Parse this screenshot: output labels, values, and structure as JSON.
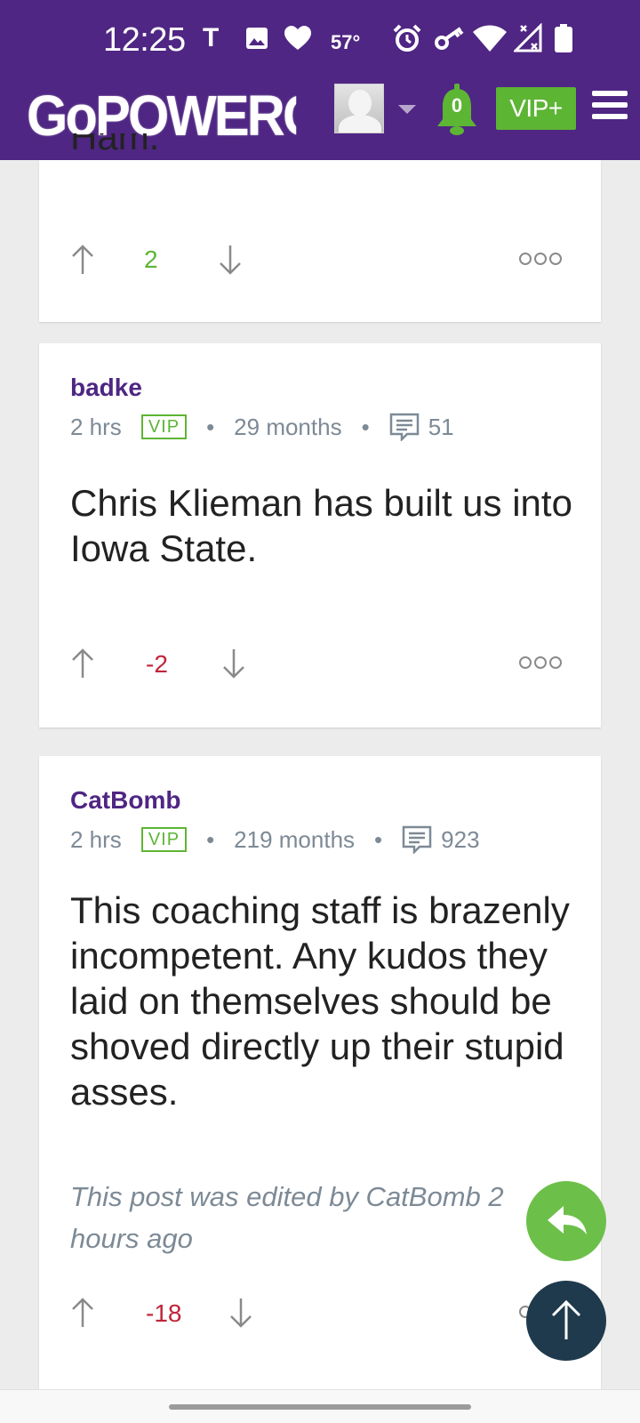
{
  "status_bar": {
    "time": "12:25",
    "temperature": "57°"
  },
  "header": {
    "logo_text": "GoPOWERCAT",
    "notification_count": "0",
    "vip_button_label": "VIP+"
  },
  "posts": [
    {
      "body_fragment": "Ham.",
      "score": "2",
      "score_color": "#5db534"
    },
    {
      "author": "badke",
      "time": "2 hrs",
      "badge": "VIP",
      "tenure": "29 months",
      "post_count": "51",
      "body": "Chris Klieman has built us into Iowa State.",
      "score": "-2",
      "score_color": "#c0243a"
    },
    {
      "author": "CatBomb",
      "time": "2 hrs",
      "badge": "VIP",
      "tenure": "219 months",
      "post_count": "923",
      "body": "This coaching staff is brazenly incompetent. Any kudos they laid on themselves should be shoved directly up their stupid asses.",
      "edit_note": "This post was edited by CatBomb 2 hours ago",
      "score": "-18",
      "score_color": "#c0243a"
    }
  ],
  "colors": {
    "brand_purple": "#4f2683",
    "vip_green": "#5db534",
    "negative_red": "#c0243a",
    "fab_dark": "#1f3a4d"
  },
  "icons": [
    "bell-icon",
    "hamburger-menu-icon",
    "upvote-arrow-icon",
    "downvote-arrow-icon",
    "more-options-icon",
    "message-icon",
    "reply-icon",
    "scroll-to-top-icon"
  ]
}
